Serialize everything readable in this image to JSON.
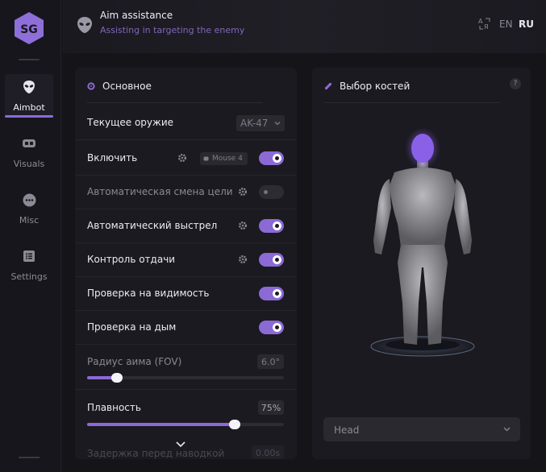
{
  "sidebar": {
    "items": [
      {
        "label": "Aimbot",
        "icon": "alien-icon",
        "active": true
      },
      {
        "label": "Visuals",
        "icon": "vr-goggles-icon",
        "active": false
      },
      {
        "label": "Misc",
        "icon": "dots-circle-icon",
        "active": false
      },
      {
        "label": "Settings",
        "icon": "list-icon",
        "active": false
      }
    ]
  },
  "header": {
    "title": "Aim assistance",
    "subtitle": "Assisting in targeting the enemy",
    "lang_en": "EN",
    "lang_ru": "RU"
  },
  "main_panel": {
    "title": "Основное",
    "weapon_label": "Текущее оружие",
    "weapon_value": "AK-47",
    "rows": [
      {
        "label": "Включить",
        "enabled": true,
        "keybind": "Mouse 4"
      },
      {
        "label": "Автоматическая смена цели",
        "enabled": false
      },
      {
        "label": "Автоматический выстрел",
        "enabled": true
      },
      {
        "label": "Контроль отдачи",
        "enabled": true
      },
      {
        "label": "Проверка на видимость",
        "enabled": true
      },
      {
        "label": "Проверка на дым",
        "enabled": true
      }
    ],
    "fov": {
      "label": "Радиус аима (FOV)",
      "value": "6.0°",
      "fraction": 0.15
    },
    "smooth": {
      "label": "Плавность",
      "value": "75%",
      "fraction": 0.75
    },
    "delay": {
      "label": "Задержка перед наводкой",
      "value": "0.00s"
    }
  },
  "bones_panel": {
    "title": "Выбор костей",
    "help": "?",
    "selected_bone": "Head"
  },
  "colors": {
    "accent": "#8b6ad6",
    "bg": "#151419",
    "panel": "#1b1a20"
  }
}
